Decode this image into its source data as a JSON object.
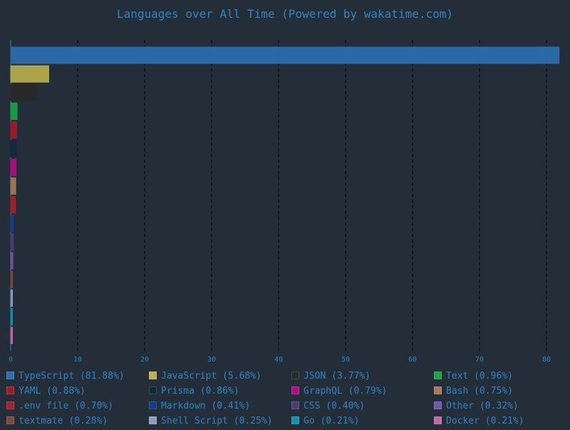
{
  "chart_data": {
    "type": "bar",
    "orientation": "horizontal",
    "title": "Languages over All Time (Powered by wakatime.com)",
    "xlabel": "",
    "ylabel": "",
    "xlim": [
      0,
      82
    ],
    "xticks": [
      0,
      10,
      20,
      30,
      40,
      50,
      60,
      70,
      80
    ],
    "grid": true,
    "legend_position": "bottom",
    "categories": [
      "TypeScript",
      "JavaScript",
      "JSON",
      "Text",
      "YAML",
      "Prisma",
      "GraphQL",
      "Bash",
      ".env file",
      "Markdown",
      "CSS",
      "Other",
      "textmate",
      "Shell Script",
      "Go",
      "Docker"
    ],
    "values": [
      81.88,
      5.68,
      3.77,
      0.96,
      0.88,
      0.86,
      0.79,
      0.75,
      0.7,
      0.41,
      0.4,
      0.32,
      0.28,
      0.25,
      0.21,
      0.21
    ],
    "colors": [
      "#2b6fb3",
      "#bcb04f",
      "#292929",
      "#18a641",
      "#a31b29",
      "#0f2a3f",
      "#b40b83",
      "#a97a55",
      "#a8202f",
      "#133f8a",
      "#4e3d73",
      "#7356a8",
      "#7a4b3f",
      "#8aa0bf",
      "#1093b3",
      "#c06aa8"
    ],
    "legend": [
      "TypeScript (81.88%)",
      "JavaScript (5.68%)",
      "JSON (3.77%)",
      "Text (0.96%)",
      "YAML (0.88%)",
      "Prisma (0.86%)",
      "GraphQL (0.79%)",
      "Bash (0.75%)",
      ".env file (0.70%)",
      "Markdown (0.41%)",
      "CSS (0.40%)",
      "Other (0.32%)",
      "textmate (0.28%)",
      "Shell Script (0.25%)",
      "Go (0.21%)",
      "Docker (0.21%)"
    ]
  }
}
